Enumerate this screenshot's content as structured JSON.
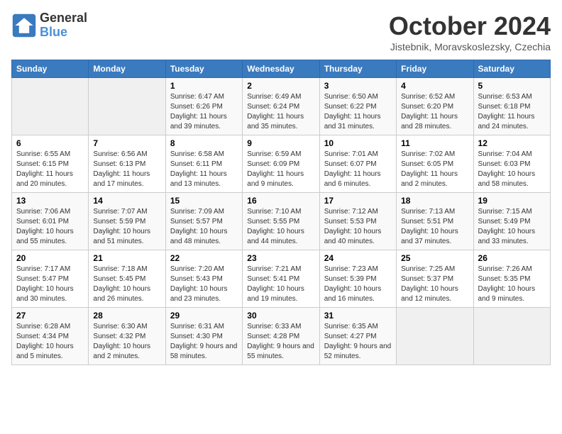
{
  "logo": {
    "text_general": "General",
    "text_blue": "Blue"
  },
  "title": "October 2024",
  "location": "Jistebnik, Moravskoslezsky, Czechia",
  "weekdays": [
    "Sunday",
    "Monday",
    "Tuesday",
    "Wednesday",
    "Thursday",
    "Friday",
    "Saturday"
  ],
  "weeks": [
    [
      {
        "day": "",
        "sunrise": "",
        "sunset": "",
        "daylight": ""
      },
      {
        "day": "",
        "sunrise": "",
        "sunset": "",
        "daylight": ""
      },
      {
        "day": "1",
        "sunrise": "Sunrise: 6:47 AM",
        "sunset": "Sunset: 6:26 PM",
        "daylight": "Daylight: 11 hours and 39 minutes."
      },
      {
        "day": "2",
        "sunrise": "Sunrise: 6:49 AM",
        "sunset": "Sunset: 6:24 PM",
        "daylight": "Daylight: 11 hours and 35 minutes."
      },
      {
        "day": "3",
        "sunrise": "Sunrise: 6:50 AM",
        "sunset": "Sunset: 6:22 PM",
        "daylight": "Daylight: 11 hours and 31 minutes."
      },
      {
        "day": "4",
        "sunrise": "Sunrise: 6:52 AM",
        "sunset": "Sunset: 6:20 PM",
        "daylight": "Daylight: 11 hours and 28 minutes."
      },
      {
        "day": "5",
        "sunrise": "Sunrise: 6:53 AM",
        "sunset": "Sunset: 6:18 PM",
        "daylight": "Daylight: 11 hours and 24 minutes."
      }
    ],
    [
      {
        "day": "6",
        "sunrise": "Sunrise: 6:55 AM",
        "sunset": "Sunset: 6:15 PM",
        "daylight": "Daylight: 11 hours and 20 minutes."
      },
      {
        "day": "7",
        "sunrise": "Sunrise: 6:56 AM",
        "sunset": "Sunset: 6:13 PM",
        "daylight": "Daylight: 11 hours and 17 minutes."
      },
      {
        "day": "8",
        "sunrise": "Sunrise: 6:58 AM",
        "sunset": "Sunset: 6:11 PM",
        "daylight": "Daylight: 11 hours and 13 minutes."
      },
      {
        "day": "9",
        "sunrise": "Sunrise: 6:59 AM",
        "sunset": "Sunset: 6:09 PM",
        "daylight": "Daylight: 11 hours and 9 minutes."
      },
      {
        "day": "10",
        "sunrise": "Sunrise: 7:01 AM",
        "sunset": "Sunset: 6:07 PM",
        "daylight": "Daylight: 11 hours and 6 minutes."
      },
      {
        "day": "11",
        "sunrise": "Sunrise: 7:02 AM",
        "sunset": "Sunset: 6:05 PM",
        "daylight": "Daylight: 11 hours and 2 minutes."
      },
      {
        "day": "12",
        "sunrise": "Sunrise: 7:04 AM",
        "sunset": "Sunset: 6:03 PM",
        "daylight": "Daylight: 10 hours and 58 minutes."
      }
    ],
    [
      {
        "day": "13",
        "sunrise": "Sunrise: 7:06 AM",
        "sunset": "Sunset: 6:01 PM",
        "daylight": "Daylight: 10 hours and 55 minutes."
      },
      {
        "day": "14",
        "sunrise": "Sunrise: 7:07 AM",
        "sunset": "Sunset: 5:59 PM",
        "daylight": "Daylight: 10 hours and 51 minutes."
      },
      {
        "day": "15",
        "sunrise": "Sunrise: 7:09 AM",
        "sunset": "Sunset: 5:57 PM",
        "daylight": "Daylight: 10 hours and 48 minutes."
      },
      {
        "day": "16",
        "sunrise": "Sunrise: 7:10 AM",
        "sunset": "Sunset: 5:55 PM",
        "daylight": "Daylight: 10 hours and 44 minutes."
      },
      {
        "day": "17",
        "sunrise": "Sunrise: 7:12 AM",
        "sunset": "Sunset: 5:53 PM",
        "daylight": "Daylight: 10 hours and 40 minutes."
      },
      {
        "day": "18",
        "sunrise": "Sunrise: 7:13 AM",
        "sunset": "Sunset: 5:51 PM",
        "daylight": "Daylight: 10 hours and 37 minutes."
      },
      {
        "day": "19",
        "sunrise": "Sunrise: 7:15 AM",
        "sunset": "Sunset: 5:49 PM",
        "daylight": "Daylight: 10 hours and 33 minutes."
      }
    ],
    [
      {
        "day": "20",
        "sunrise": "Sunrise: 7:17 AM",
        "sunset": "Sunset: 5:47 PM",
        "daylight": "Daylight: 10 hours and 30 minutes."
      },
      {
        "day": "21",
        "sunrise": "Sunrise: 7:18 AM",
        "sunset": "Sunset: 5:45 PM",
        "daylight": "Daylight: 10 hours and 26 minutes."
      },
      {
        "day": "22",
        "sunrise": "Sunrise: 7:20 AM",
        "sunset": "Sunset: 5:43 PM",
        "daylight": "Daylight: 10 hours and 23 minutes."
      },
      {
        "day": "23",
        "sunrise": "Sunrise: 7:21 AM",
        "sunset": "Sunset: 5:41 PM",
        "daylight": "Daylight: 10 hours and 19 minutes."
      },
      {
        "day": "24",
        "sunrise": "Sunrise: 7:23 AM",
        "sunset": "Sunset: 5:39 PM",
        "daylight": "Daylight: 10 hours and 16 minutes."
      },
      {
        "day": "25",
        "sunrise": "Sunrise: 7:25 AM",
        "sunset": "Sunset: 5:37 PM",
        "daylight": "Daylight: 10 hours and 12 minutes."
      },
      {
        "day": "26",
        "sunrise": "Sunrise: 7:26 AM",
        "sunset": "Sunset: 5:35 PM",
        "daylight": "Daylight: 10 hours and 9 minutes."
      }
    ],
    [
      {
        "day": "27",
        "sunrise": "Sunrise: 6:28 AM",
        "sunset": "Sunset: 4:34 PM",
        "daylight": "Daylight: 10 hours and 5 minutes."
      },
      {
        "day": "28",
        "sunrise": "Sunrise: 6:30 AM",
        "sunset": "Sunset: 4:32 PM",
        "daylight": "Daylight: 10 hours and 2 minutes."
      },
      {
        "day": "29",
        "sunrise": "Sunrise: 6:31 AM",
        "sunset": "Sunset: 4:30 PM",
        "daylight": "Daylight: 9 hours and 58 minutes."
      },
      {
        "day": "30",
        "sunrise": "Sunrise: 6:33 AM",
        "sunset": "Sunset: 4:28 PM",
        "daylight": "Daylight: 9 hours and 55 minutes."
      },
      {
        "day": "31",
        "sunrise": "Sunrise: 6:35 AM",
        "sunset": "Sunset: 4:27 PM",
        "daylight": "Daylight: 9 hours and 52 minutes."
      },
      {
        "day": "",
        "sunrise": "",
        "sunset": "",
        "daylight": ""
      },
      {
        "day": "",
        "sunrise": "",
        "sunset": "",
        "daylight": ""
      }
    ]
  ]
}
